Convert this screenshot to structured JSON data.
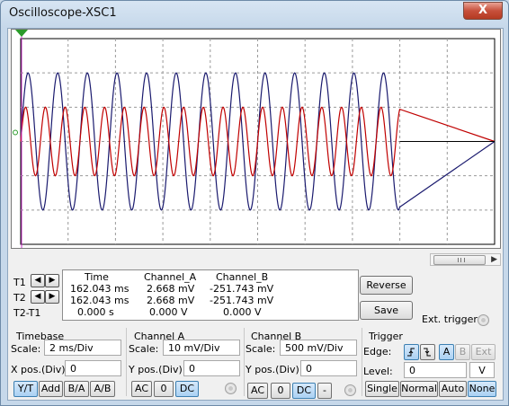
{
  "window": {
    "title": "Oscilloscope-XSC1",
    "close_label": "X"
  },
  "cursors": {
    "t1": "T1",
    "t2": "T2",
    "t2_t1": "T2-T1"
  },
  "readout": {
    "headers": [
      "Time",
      "Channel_A",
      "Channel_B"
    ],
    "rows": [
      [
        "162.043 ms",
        "2.668 mV",
        "-251.743 mV"
      ],
      [
        "162.043 ms",
        "2.668 mV",
        "-251.743 mV"
      ],
      [
        "0.000 s",
        "0.000 V",
        "0.000 V"
      ]
    ]
  },
  "buttons": {
    "reverse": "Reverse",
    "save": "Save",
    "ext_trigger": "Ext. trigger"
  },
  "timebase": {
    "title": "Timebase",
    "scale_label": "Scale:",
    "scale_value": "2 ms/Div",
    "xpos_label": "X pos.(Div):",
    "xpos_value": "0",
    "modes": [
      "Y/T",
      "Add",
      "B/A",
      "A/B"
    ],
    "active_mode": "Y/T"
  },
  "channel_a": {
    "title": "Channel A",
    "scale_label": "Scale:",
    "scale_value": "10 mV/Div",
    "ypos_label": "Y pos.(Div):",
    "ypos_value": "0",
    "coupling": [
      "AC",
      "0",
      "DC"
    ],
    "active_coupling": "DC"
  },
  "channel_b": {
    "title": "Channel B",
    "scale_label": "Scale:",
    "scale_value": "500 mV/Div",
    "ypos_label": "Y pos.(Div):",
    "ypos_value": "0",
    "coupling": [
      "AC",
      "0",
      "DC",
      "-"
    ],
    "active_coupling": "DC"
  },
  "trigger": {
    "title": "Trigger",
    "edge_label": "Edge:",
    "sources": [
      "A",
      "B",
      "Ext"
    ],
    "level_label": "Level:",
    "level_value": "0",
    "level_unit": "V",
    "modes": [
      "Single",
      "Normal",
      "Auto",
      "None"
    ],
    "active_mode": "None"
  },
  "colors": {
    "channel_a": "#c00000",
    "channel_b": "#1a1a6e",
    "cursor": "#cc33cc",
    "grid": "#9a9a9a"
  },
  "waveforms": {
    "channel_a": {
      "amplitude_div": 1.0,
      "cycles_visible": 24
    },
    "channel_b": {
      "amplitude_div": 2.0,
      "cycles_visible": 16
    },
    "signal_end_fraction": 0.8,
    "grid_divisions": {
      "x": 10,
      "y": 6
    }
  }
}
